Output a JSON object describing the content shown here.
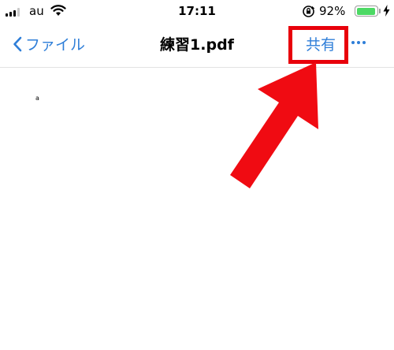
{
  "status_bar": {
    "carrier": "au",
    "time": "17:11",
    "battery_percent": "92%",
    "battery_level": 0.92,
    "icons": [
      "signal-icon",
      "wifi-icon",
      "rotation-lock-icon",
      "battery-icon",
      "charging-bolt-icon"
    ]
  },
  "nav": {
    "back_label": "ファイル",
    "title": "練習1.pdf",
    "share_label": "共有",
    "more_icon": "ellipsis-icon"
  },
  "document": {
    "text": "a"
  },
  "colors": {
    "accent": "#2e7ed8",
    "annotation_red": "#e8000b",
    "battery_green": "#4cd964"
  }
}
